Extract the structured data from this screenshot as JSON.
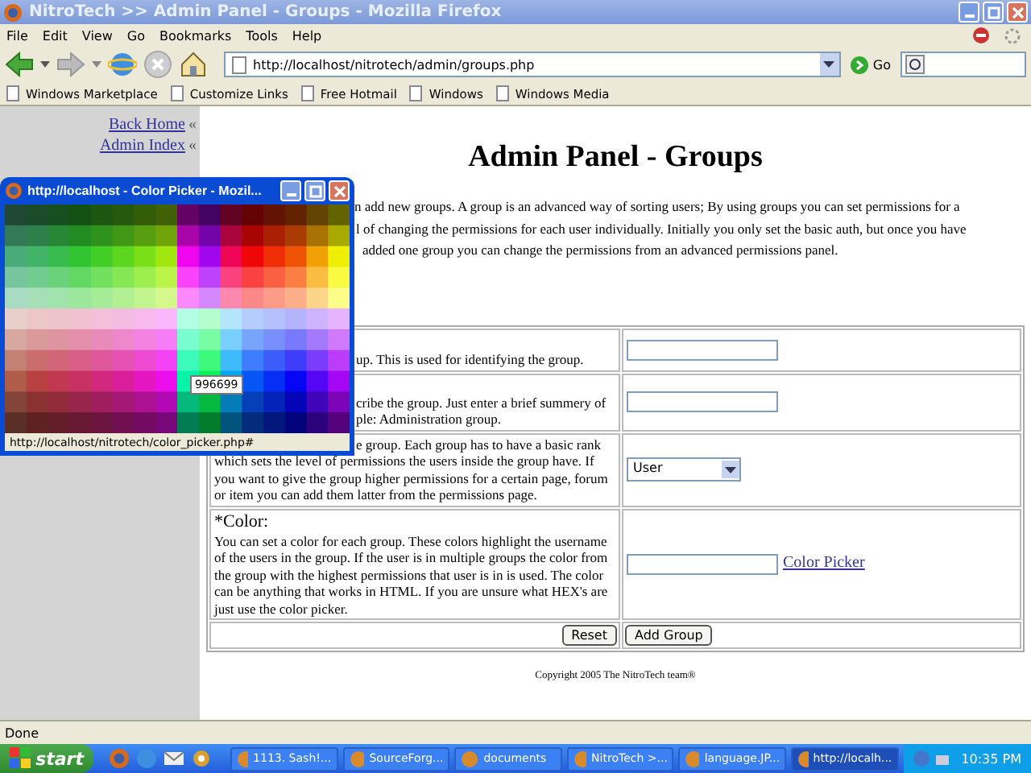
{
  "window": {
    "title": "NitroTech >> Admin Panel - Groups - Mozilla Firefox"
  },
  "menu": [
    "File",
    "Edit",
    "View",
    "Go",
    "Bookmarks",
    "Tools",
    "Help"
  ],
  "address": {
    "value": "http://localhost/nitrotech/admin/groups.php"
  },
  "go_label": "Go",
  "bookmarks": [
    "Windows Marketplace",
    "Customize Links",
    "Free Hotmail",
    "Windows",
    "Windows Media"
  ],
  "sidebar": {
    "links": [
      {
        "label": "Back Home",
        "marker": "«"
      },
      {
        "label": "Admin Index",
        "marker": "«"
      }
    ]
  },
  "page": {
    "heading": "Admin Panel - Groups",
    "intro_lines": [
      "n add new groups.  A group is an advanced way of sorting users; By using groups you can set permissions for a",
      "l of changing the permissions for each user individually. Initially you only set the basic auth, but once you have",
      "added one group you can change the permissions from an advanced permissions panel."
    ],
    "rows": [
      {
        "kind": "text",
        "fragments": [
          "up. This is used for identifying the group."
        ]
      },
      {
        "kind": "text",
        "fragments": [
          "cribe the group. Just enter a brief summery of",
          "ple: Administration group."
        ]
      },
      {
        "kind": "select",
        "fragments": [
          "e group. Each group has to have a basic rank"
        ],
        "description": "which sets the level of permissions the users inside the group have. If you want to give the group higher permissions for a certain page, forum or item you can add them latter from the permissions page.",
        "value": "User"
      },
      {
        "kind": "color",
        "label": "*Color:",
        "description": "You can set a color for each group. These colors highlight the username of the users in the group. If the user is in multiple groups the color from the group with the highest permissions that user is in is used. The color can be anything that works in HTML. If you are unsure what HEX's are just use the color picker.",
        "link": "Color Picker"
      }
    ],
    "buttons": [
      "Reset",
      "Add Group"
    ],
    "footer": "Copyright 2005 The NitroTech team®"
  },
  "popup": {
    "title": "http://localhost - Color Picker - Mozil...",
    "tooltip": "996699",
    "status": "http://localhost/nitrotech/color_picker.php#"
  },
  "status_bar": "Done",
  "taskbar": {
    "start": "start",
    "tasks": [
      {
        "label": "1113. Sash!...",
        "selected": false
      },
      {
        "label": "SourceForg...",
        "selected": false
      },
      {
        "label": "documents",
        "selected": false
      },
      {
        "label": "NitroTech >...",
        "selected": false
      },
      {
        "label": "language.JP...",
        "selected": false
      },
      {
        "label": "http://localh...",
        "selected": true
      }
    ],
    "clock": "10:35 PM"
  }
}
